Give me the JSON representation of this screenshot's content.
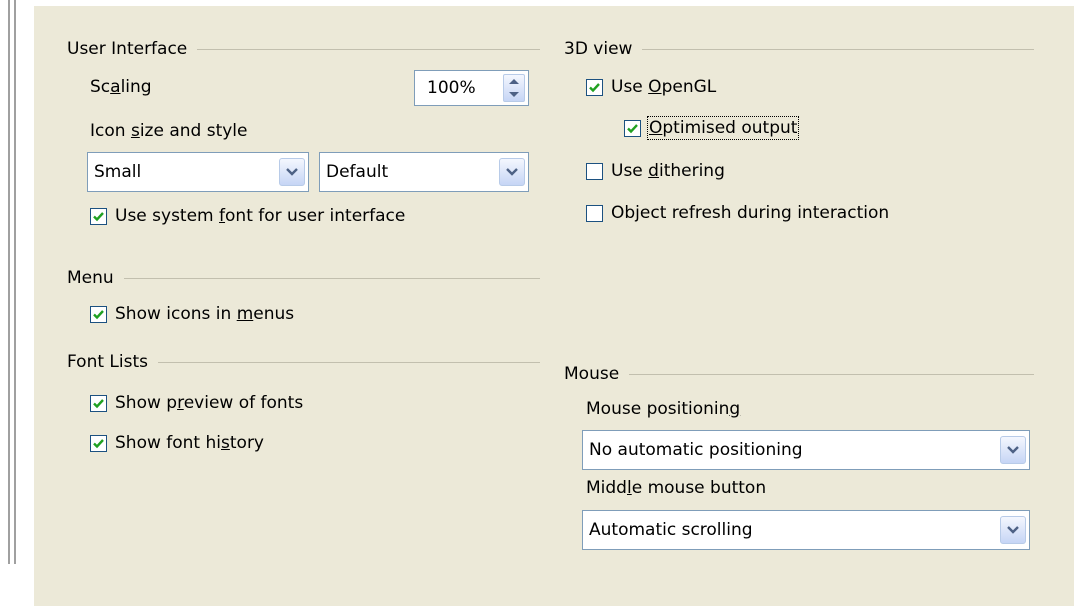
{
  "ui": {
    "title": "User Interface",
    "scaling_pre": "Sc",
    "scaling_ul": "a",
    "scaling_post": "ling",
    "scaling_value": "100%",
    "iconsize_pre": "Icon ",
    "iconsize_ul": "s",
    "iconsize_post": "ize and style",
    "icon_size_value": "Small",
    "icon_style_value": "Default",
    "sysfont_pre": "Use system ",
    "sysfont_ul": "f",
    "sysfont_post": "ont for user interface"
  },
  "menu": {
    "title": "Menu",
    "icons_pre": "Show icons in ",
    "icons_ul": "m",
    "icons_post": "enus"
  },
  "fontlists": {
    "title": "Font Lists",
    "preview_pre": "Show p",
    "preview_ul": "r",
    "preview_post": "eview of fonts",
    "history_pre": "Show font hi",
    "history_ul": "s",
    "history_post": "tory"
  },
  "view3d": {
    "title": "3D view",
    "opengl_pre": "Use ",
    "opengl_ul": "O",
    "opengl_post": "penGL",
    "optimised_pre": "",
    "optimised_ul": "O",
    "optimised_post": "ptimised output",
    "dither_pre": "Use ",
    "dither_ul": "d",
    "dither_post": "ithering",
    "refresh_pre": "Ob",
    "refresh_ul": "j",
    "refresh_post": "ect refresh during interaction"
  },
  "mouse": {
    "title": "Mouse",
    "positioning_pre": "Mouse positionin",
    "positioning_ul": "g",
    "positioning_post": "",
    "positioning_value": "No automatic positioning",
    "middle_pre": "Midd",
    "middle_ul": "l",
    "middle_post": "e mouse button",
    "middle_value": "Automatic scrolling"
  },
  "icons": {
    "check": "check-icon",
    "dropdown": "chevron-down-icon",
    "spin": "spin-arrows-icon"
  },
  "colors": {
    "panel_bg": "#ece9d8",
    "checkbox_border": "#1c5180",
    "check_mark": "#21a121",
    "field_border": "#7f9db9"
  }
}
